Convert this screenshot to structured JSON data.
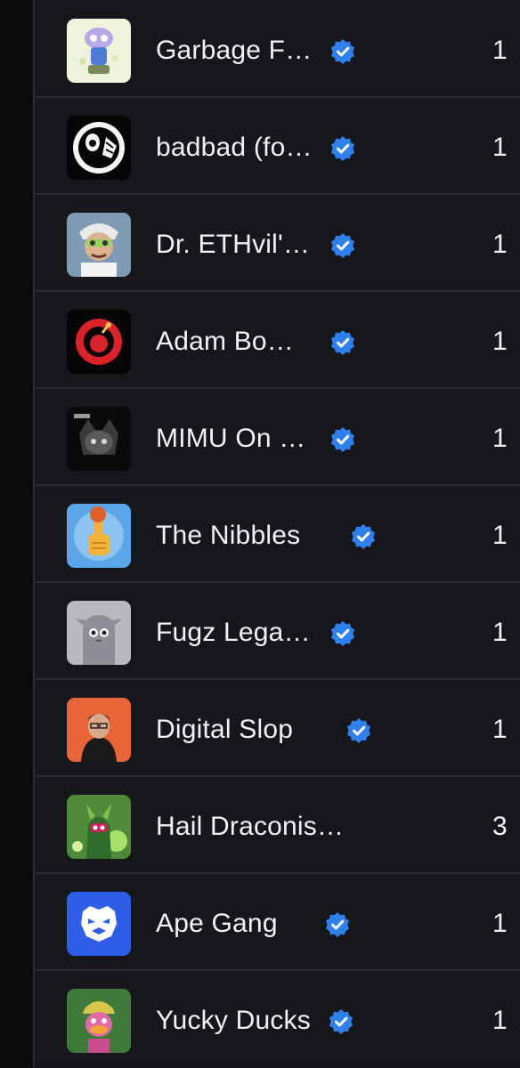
{
  "collections": [
    {
      "name": "Garbage F…",
      "count": "1",
      "icon": "garbage-avatar"
    },
    {
      "name": "badbad (fo…",
      "count": "1",
      "icon": "skull-avatar"
    },
    {
      "name": "Dr. ETHvil'…",
      "count": "1",
      "icon": "doctor-avatar"
    },
    {
      "name": "Adam Bo…",
      "count": "1",
      "icon": "bomb-squad-avatar"
    },
    {
      "name": "MIMU On …",
      "count": "1",
      "icon": "mimu-avatar"
    },
    {
      "name": "The Nibbles",
      "count": "1",
      "icon": "thumbs-up-avatar"
    },
    {
      "name": "Fugz Lega…",
      "count": "1",
      "icon": "fugz-avatar"
    },
    {
      "name": "Digital Slop",
      "count": "1",
      "icon": "hooded-figure-avatar"
    },
    {
      "name": "Hail Draconis…",
      "count": "3",
      "icon": "dragon-avatar"
    },
    {
      "name": "Ape Gang",
      "count": "1",
      "icon": "ape-gang-avatar"
    },
    {
      "name": "Yucky Ducks",
      "count": "1",
      "icon": "duck-avatar"
    }
  ],
  "colors": {
    "background": "#16171b",
    "divider": "#2b2c31",
    "text": "#f2f2f4",
    "verified": "#2f80ed"
  }
}
